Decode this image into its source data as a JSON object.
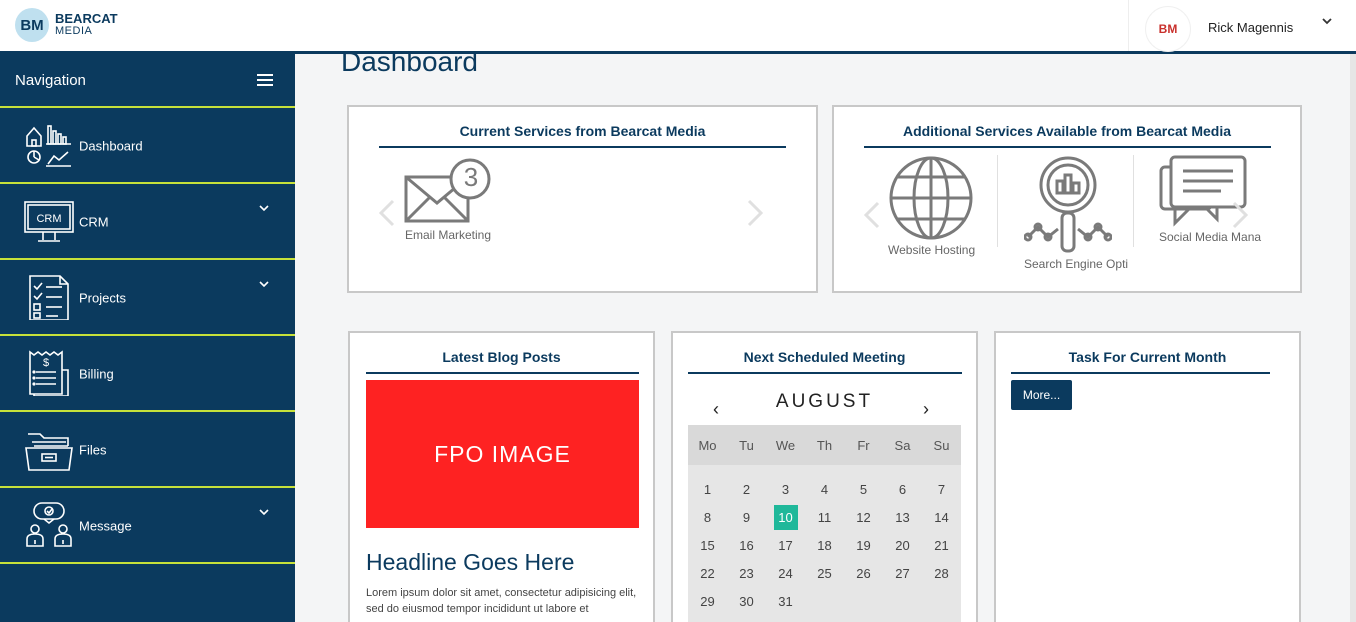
{
  "brand": {
    "logo_mark": "BM",
    "name_line1": "BEARCAT",
    "name_line2": "MEDIA"
  },
  "user": {
    "avatar_text": "BM",
    "name": "Rick Magennis",
    "menu_icon": "chevron-down-icon"
  },
  "sidebar": {
    "title": "Navigation",
    "toggle_icon": "hamburger-icon",
    "items": [
      {
        "label": "Dashboard",
        "icon": "dashboard-icon",
        "expandable": false
      },
      {
        "label": "CRM",
        "icon": "crm-icon",
        "icon_text": "CRM",
        "expandable": true
      },
      {
        "label": "Projects",
        "icon": "checklist-icon",
        "expandable": true
      },
      {
        "label": "Billing",
        "icon": "invoice-icon",
        "expandable": false
      },
      {
        "label": "Files",
        "icon": "folder-icon",
        "expandable": false
      },
      {
        "label": "Message",
        "icon": "chat-icon",
        "expandable": true
      }
    ]
  },
  "page": {
    "title": "Dashboard"
  },
  "current_services": {
    "title": "Current Services from Bearcat Media",
    "items": [
      {
        "label": "Email Marketing",
        "badge": "3",
        "icon": "envelope-icon"
      }
    ]
  },
  "additional_services": {
    "title": "Additional Services Available from Bearcat Media",
    "items": [
      {
        "label": "Website Hosting",
        "icon": "globe-icon"
      },
      {
        "label": "Search Engine Opti",
        "icon": "seo-magnifier-icon"
      },
      {
        "label": "Social Media Mana",
        "icon": "chat-bubbles-icon"
      }
    ]
  },
  "blog": {
    "title": "Latest Blog Posts",
    "image_text": "FPO IMAGE",
    "headline": "Headline Goes Here",
    "excerpt": "Lorem ipsum dolor sit amet, consectetur adipisicing elit, sed do eiusmod tempor incididunt ut labore et"
  },
  "meeting": {
    "title": "Next Scheduled Meeting",
    "month": "AUGUST",
    "prev": "‹",
    "next": "›",
    "weekdays": [
      "Mo",
      "Tu",
      "We",
      "Th",
      "Fr",
      "Sa",
      "Su"
    ],
    "days": [
      "1",
      "2",
      "3",
      "4",
      "5",
      "6",
      "7",
      "8",
      "9",
      "10",
      "11",
      "12",
      "13",
      "14",
      "15",
      "16",
      "17",
      "18",
      "19",
      "20",
      "21",
      "22",
      "23",
      "24",
      "25",
      "26",
      "27",
      "28",
      "29",
      "30",
      "31"
    ],
    "today": "10",
    "today_color": "#1fb89a"
  },
  "tasks": {
    "title": "Task For Current Month",
    "more_label": "More..."
  },
  "colors": {
    "navy": "#0b3a5e",
    "accent_line": "#c6e13a",
    "fpo_red": "#fe2222"
  }
}
